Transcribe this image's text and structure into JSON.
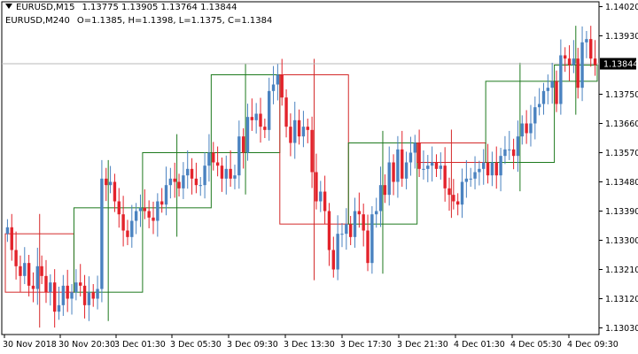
{
  "header": {
    "symbol_line": "EURUSD,M15",
    "m15_quote": "1.13775 1.13905 1.13764 1.13844",
    "indicator_symbol": "EURUSD,M240",
    "indicator_values": "O=1.1385,  H=1.1398,  L=1.1375,  C=1.1384"
  },
  "current_price": {
    "value": 1.13844,
    "label": "1.13844"
  },
  "colors": {
    "bull": "#4a82c0",
    "bear": "#e3232b",
    "htf_bull_box": "#1e7a1e",
    "htf_bear_box": "#d42a2a",
    "price_line": "#b9b9b9",
    "axis": "#000000",
    "price_label_bg": "#000000",
    "price_label_fg": "#ffffff"
  },
  "chart_data": {
    "type": "candlestick",
    "symbol": "EURUSD",
    "timeframe": "M15",
    "overlay_timeframe": "M240",
    "y_ticks": [
      "1.14020",
      "1.13930",
      "1.13750",
      "1.13660",
      "1.13570",
      "1.13480",
      "1.13390",
      "1.13300",
      "1.13210",
      "1.13120",
      "1.13030"
    ],
    "y_tick_values": [
      1.1402,
      1.1393,
      1.1375,
      1.1366,
      1.1357,
      1.1348,
      1.1339,
      1.133,
      1.1321,
      1.1312,
      1.1303
    ],
    "y_range": [
      1.13,
      1.1405
    ],
    "x_ticks": [
      "30 Nov 2018",
      "30 Nov 20:30",
      "3 Dec 01:30",
      "3 Dec 05:30",
      "3 Dec 09:30",
      "3 Dec 13:30",
      "3 Dec 17:30",
      "3 Dec 21:30",
      "4 Dec 01:30",
      "4 Dec 05:30",
      "4 Dec 09:30"
    ],
    "m15_closes": [
      1.1334,
      1.1327,
      1.1322,
      1.1319,
      1.1323,
      1.1316,
      1.1315,
      1.1322,
      1.1319,
      1.1314,
      1.1317,
      1.1308,
      1.131,
      1.1316,
      1.1312,
      1.1314,
      1.1317,
      1.1316,
      1.131,
      1.1314,
      1.1312,
      1.1315,
      1.1349,
      1.1347,
      1.1348,
      1.1342,
      1.1338,
      1.1333,
      1.1331,
      1.1336,
      1.1339,
      1.134,
      1.1339,
      1.1337,
      1.1336,
      1.1342,
      1.1341,
      1.1347,
      1.1349,
      1.1348,
      1.1346,
      1.135,
      1.1352,
      1.1349,
      1.1347,
      1.1347,
      1.1353,
      1.1357,
      1.1354,
      1.1353,
      1.1349,
      1.1352,
      1.1349,
      1.135,
      1.1362,
      1.1357,
      1.1368,
      1.1367,
      1.1369,
      1.1365,
      1.1364,
      1.1376,
      1.1378,
      1.1381,
      1.1374,
      1.1365,
      1.136,
      1.1367,
      1.1362,
      1.1365,
      1.1364,
      1.1351,
      1.1342,
      1.1345,
      1.1339,
      1.1327,
      1.1321,
      1.1332,
      1.1332,
      1.1335,
      1.1331,
      1.1339,
      1.1338,
      1.1333,
      1.1323,
      1.1338,
      1.1339,
      1.1347,
      1.1344,
      1.1354,
      1.1348,
      1.1358,
      1.1349,
      1.1354,
      1.1357,
      1.136,
      1.1352,
      1.1352,
      1.1353,
      1.1354,
      1.1352,
      1.1353,
      1.1346,
      1.1344,
      1.1342,
      1.1341,
      1.1348,
      1.1349,
      1.1349,
      1.1351,
      1.1352,
      1.1354,
      1.135,
      1.1354,
      1.135,
      1.1356,
      1.1358,
      1.1358,
      1.1356,
      1.1362,
      1.1366,
      1.1363,
      1.1366,
      1.1371,
      1.1372,
      1.1376,
      1.1377,
      1.1379,
      1.1372,
      1.1387,
      1.1386,
      1.1384,
      1.1386,
      1.1377,
      1.1391,
      1.1392,
      1.1386,
      1.1384
    ]
  }
}
